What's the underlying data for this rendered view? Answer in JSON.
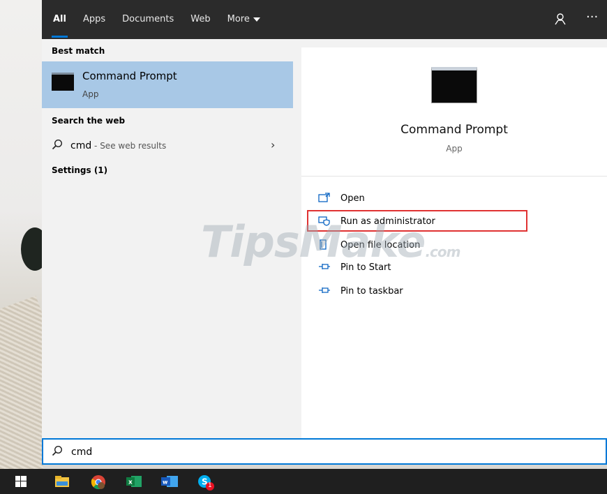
{
  "tabs": [
    {
      "label": "All"
    },
    {
      "label": "Apps"
    },
    {
      "label": "Documents"
    },
    {
      "label": "Web"
    },
    {
      "label": "More"
    }
  ],
  "sections": {
    "best_match": "Best match",
    "search_web": "Search the web",
    "settings": "Settings (1)"
  },
  "best_result": {
    "name": "Command Prompt",
    "type": "App"
  },
  "web_result": {
    "query": "cmd",
    "suffix": " - See web results"
  },
  "preview": {
    "title": "Command Prompt",
    "subtitle": "App"
  },
  "actions": [
    {
      "label": "Open",
      "icon": "open-icon"
    },
    {
      "label": "Run as administrator",
      "icon": "shield-admin-icon"
    },
    {
      "label": "Open file location",
      "icon": "file-location-icon"
    },
    {
      "label": "Pin to Start",
      "icon": "pin-icon"
    },
    {
      "label": "Pin to taskbar",
      "icon": "pin-icon"
    }
  ],
  "watermark": {
    "main": "TipsMake",
    "suffix": ".com"
  },
  "search": {
    "value": "cmd"
  },
  "taskbar": [
    "windows-start-icon",
    "file-explorer-icon",
    "chrome-icon",
    "excel-icon",
    "word-icon",
    "skype-icon"
  ],
  "skype_badge": "1",
  "colors": {
    "accent": "#0078d7",
    "selected": "#a8c8e6",
    "highlight": "#e03232",
    "topbar": "#2b2b2b"
  }
}
